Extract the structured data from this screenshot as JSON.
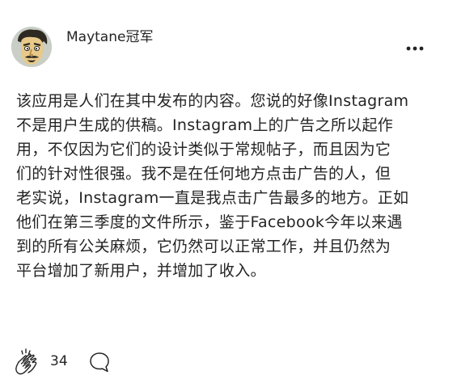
{
  "post": {
    "author": {
      "name": "Maytane冠军",
      "avatar_icon": "cartoon-face-avatar"
    },
    "menu_icon": "more-horizontal-icon",
    "body": "该应用是人们在其中发布的内容。您说的好像Instagram\n不是用户生成的供稿。Instagram上的广告之所以起作\n用，不仅因为它们的设计类似于常规帖子，而且因为它\n们的针对性很强。我不是在任何地方点击广告的人，但\n老实说，Instagram一直是我点击广告最多的地方。正如\n他们在第三季度的文件所示，鉴于Facebook今年以来遇\n到的所有公关麻烦，它仍然可以正常工作，并且仍然为\n平台增加了新用户，并增加了收入。",
    "footer": {
      "clap_icon": "clap-icon",
      "clap_count": "34",
      "comment_icon": "comment-icon"
    }
  }
}
